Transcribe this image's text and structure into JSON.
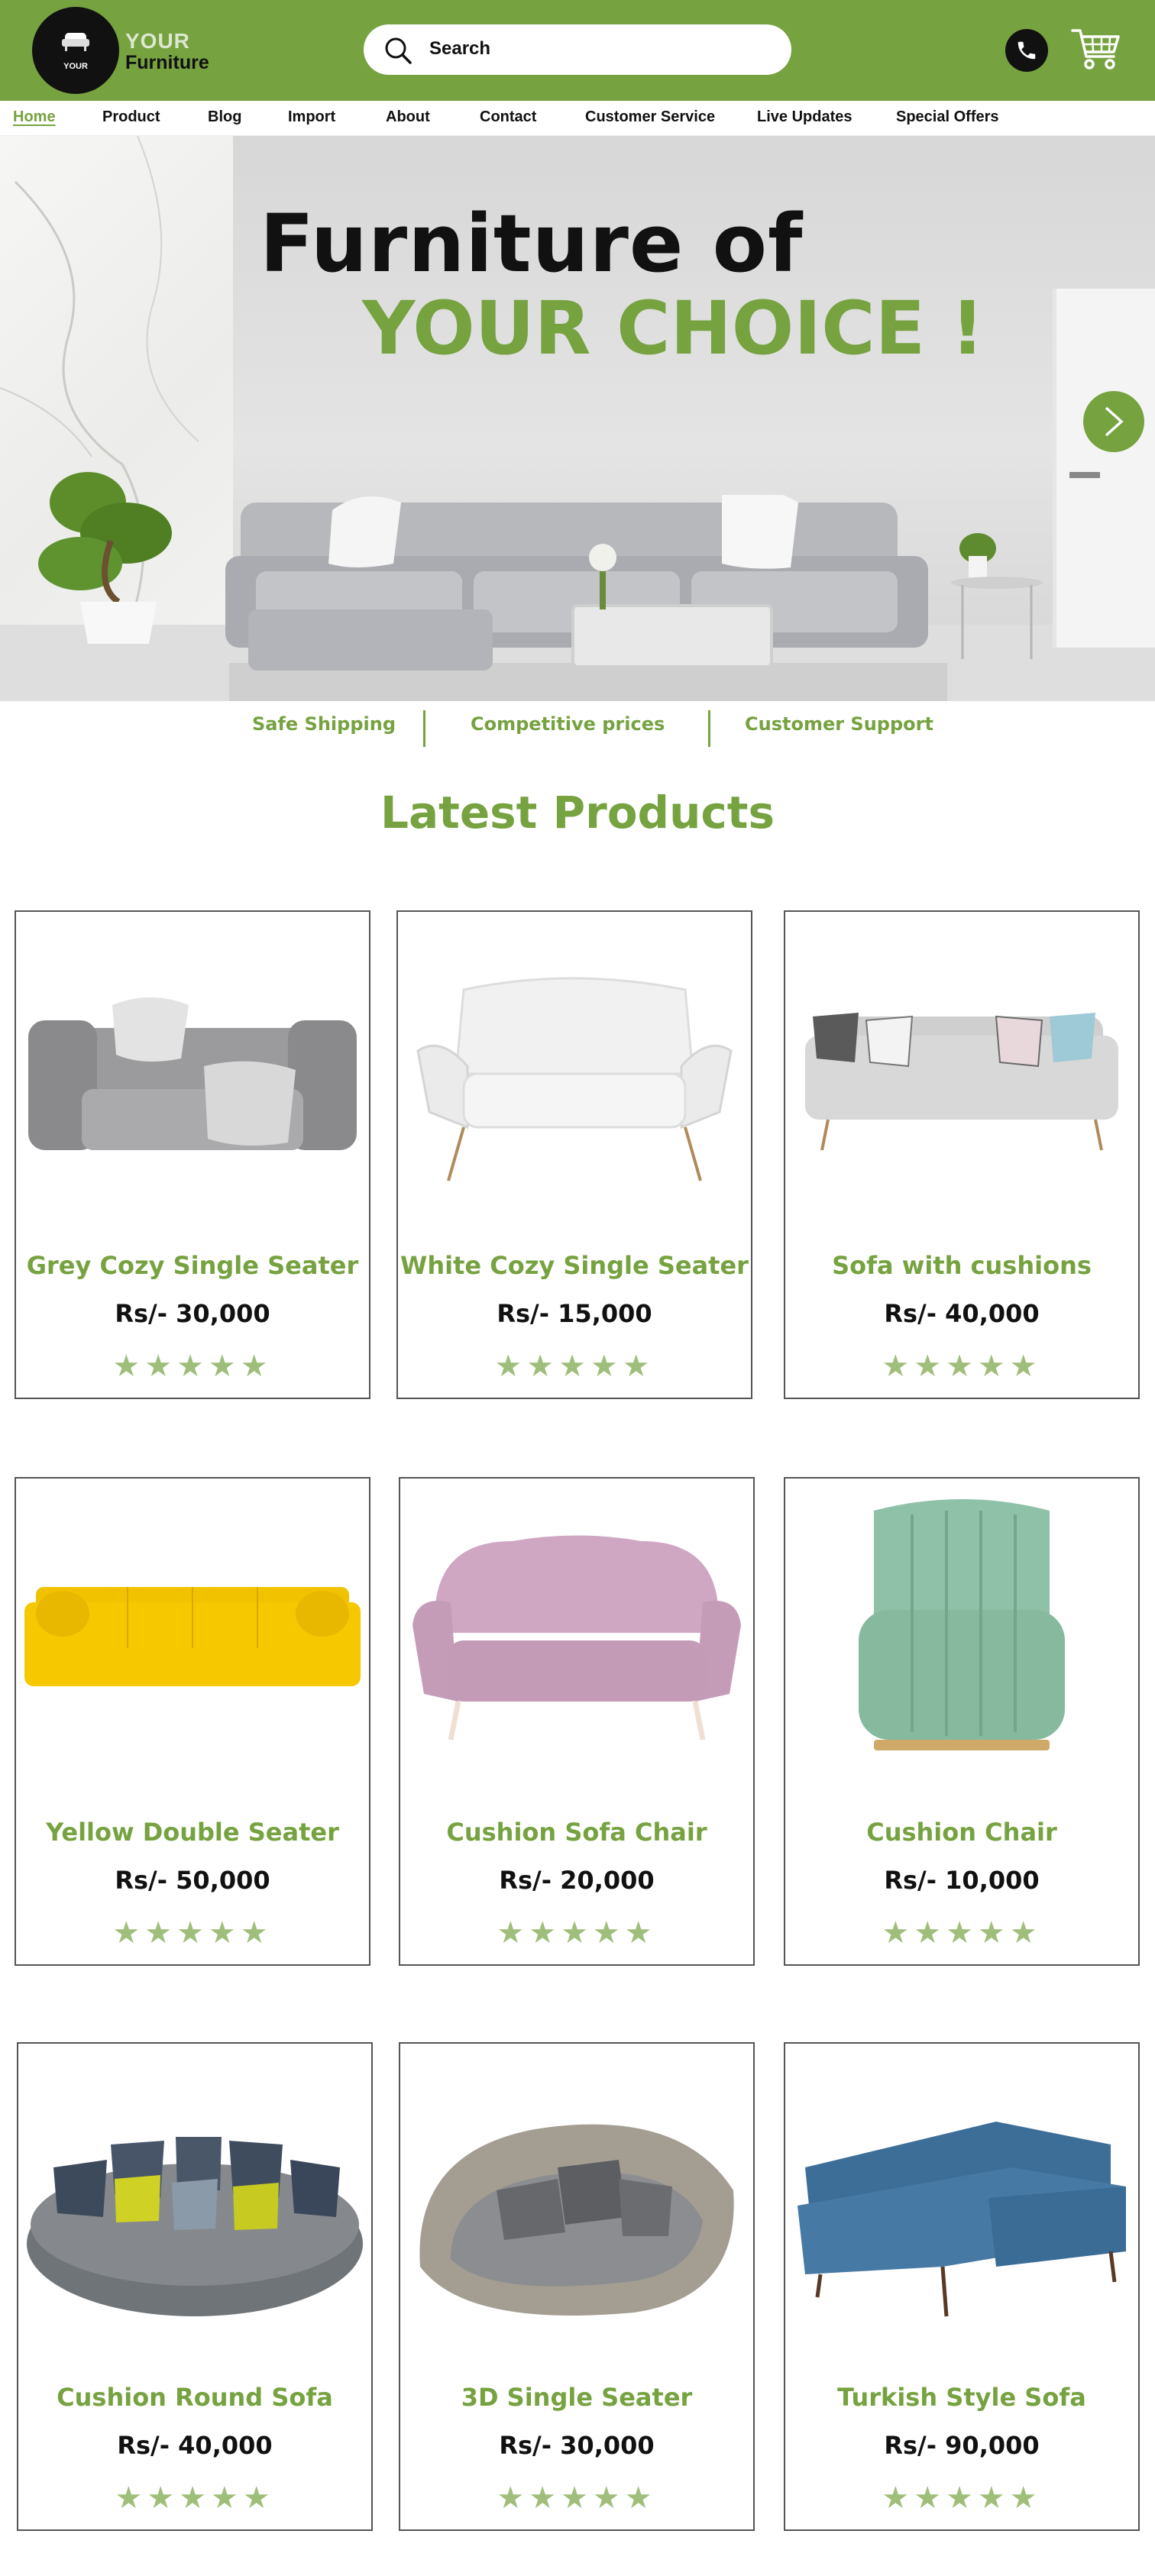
{
  "brand": {
    "logo_small": "YOUR",
    "name_top": "YOUR",
    "name_bottom": "Furniture"
  },
  "search": {
    "placeholder": "Search"
  },
  "header_icons": [
    "search-icon",
    "phone-icon",
    "cart-icon"
  ],
  "nav": [
    {
      "label": "Home",
      "active": true
    },
    {
      "label": "Product"
    },
    {
      "label": "Blog"
    },
    {
      "label": "Import"
    },
    {
      "label": "About"
    },
    {
      "label": "Contact"
    },
    {
      "label": "Customer Service"
    },
    {
      "label": "Live Updates"
    },
    {
      "label": "Special Offers"
    }
  ],
  "hero": {
    "title_line1": "Furniture of",
    "title_line2": "YOUR CHOICE !"
  },
  "features": [
    "Safe Shipping",
    "Competitive prices",
    "Customer Support"
  ],
  "section_title": "Latest Products",
  "rating_stars": "★★★★★",
  "products": [
    {
      "name": "Grey Cozy Single Seater",
      "price": "Rs/- 30,000",
      "rating": 5
    },
    {
      "name": "White Cozy Single Seater",
      "price": "Rs/- 15,000",
      "rating": 5
    },
    {
      "name": "Sofa with cushions",
      "price": "Rs/- 40,000",
      "rating": 5
    },
    {
      "name": "Yellow Double Seater",
      "price": "Rs/- 50,000",
      "rating": 5
    },
    {
      "name": "Cushion Sofa Chair",
      "price": "Rs/- 20,000",
      "rating": 5
    },
    {
      "name": "Cushion Chair",
      "price": "Rs/- 10,000",
      "rating": 5
    },
    {
      "name": "Cushion Round Sofa",
      "price": "Rs/- 40,000",
      "rating": 5
    },
    {
      "name": "3D Single Seater",
      "price": "Rs/- 30,000",
      "rating": 5
    },
    {
      "name": "Turkish Style Sofa",
      "price": "Rs/- 90,000",
      "rating": 5
    }
  ],
  "colors": {
    "brand_green": "#76a240",
    "star_green": "#9fbe7a",
    "text_dark": "#111111"
  }
}
